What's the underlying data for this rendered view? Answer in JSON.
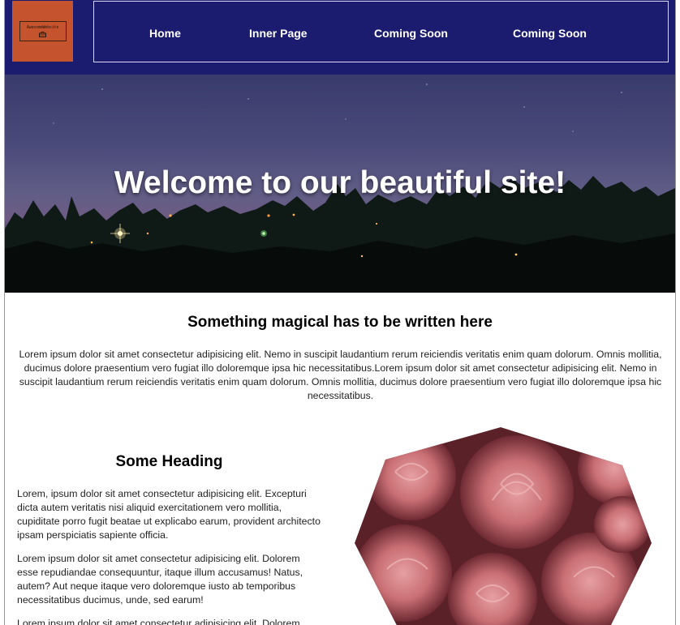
{
  "logo": {
    "text": "AwesomeWebsite",
    "icon": "briefcase-icon",
    "background": "#c5532e"
  },
  "nav": {
    "items": [
      "Home",
      "Inner Page",
      "Coming Soon",
      "Coming Soon"
    ],
    "background": "#1b1c70"
  },
  "hero": {
    "title": "Welcome to our beautiful site!"
  },
  "intro": {
    "heading": "Something magical has to be written here",
    "text": "Lorem ipsum dolor sit amet consectetur adipisicing elit. Nemo in suscipit laudantium rerum reiciendis veritatis enim quam dolorum. Omnis mollitia, ducimus dolore praesentium vero fugiat illo doloremque ipsa hic necessitatibus.Lorem ipsum dolor sit amet consectetur adipisicing elit. Nemo in suscipit laudantium rerum reiciendis veritatis enim quam dolorum. Omnis mollitia, ducimus dolore praesentium vero fugiat illo doloremque ipsa hic necessitatibus."
  },
  "section": {
    "heading": "Some Heading",
    "paragraphs": [
      "Lorem, ipsum dolor sit amet consectetur adipisicing elit. Excepturi dicta autem veritatis nisi aliquid exercitationem vero mollitia, cupiditate porro fugit beatae ut explicabo earum, provident architecto ipsam perspiciatis sapiente officia.",
      "Lorem ipsum dolor sit amet consectetur adipisicing elit. Dolorem esse repudiandae consequuntur, itaque illum accusamus! Natus, autem? Aut neque itaque vero doloremque iusto ab temporibus necessitatibus ducimus, unde, sed earum!",
      "Lorem ipsum dolor sit amet consectetur adipisicing elit. Dolorem"
    ]
  }
}
